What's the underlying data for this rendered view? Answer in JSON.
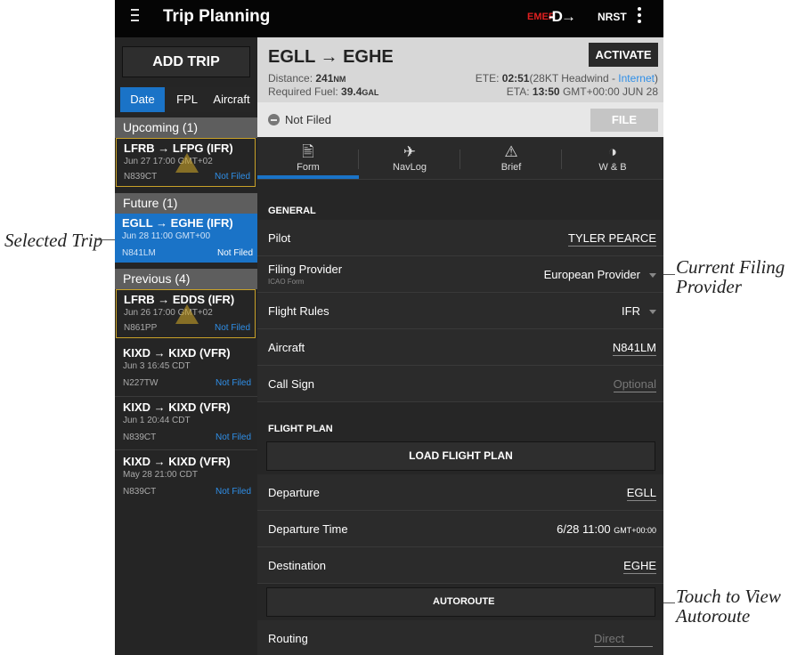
{
  "annotations": {
    "selected_trip": "Selected Trip",
    "current_filing_provider": [
      "Current Filing",
      "Provider"
    ],
    "touch_autoroute": [
      "Touch to View",
      "Autoroute"
    ]
  },
  "topbar": {
    "title": "Trip Planning",
    "emer": "EMER",
    "direct_to": "-D→",
    "nrst": "NRST"
  },
  "left": {
    "add_trip": "ADD TRIP",
    "segments": [
      "Date",
      "FPL",
      "Aircraft"
    ],
    "sections": {
      "upcoming": "Upcoming (1)",
      "future": "Future (1)",
      "previous": "Previous (4)"
    },
    "trips": [
      {
        "route": "LFRB → LFPG (IFR)",
        "date": "Jun 27 17:00 GMT+02",
        "tail": "N839CT",
        "status": "Not Filed"
      },
      {
        "route": "EGLL → EGHE (IFR)",
        "date": "Jun 28 11:00 GMT+00",
        "tail": "N841LM",
        "status": "Not Filed"
      },
      {
        "route": "LFRB → EDDS (IFR)",
        "date": "Jun 26 17:00 GMT+02",
        "tail": "N861PP",
        "status": "Not Filed"
      },
      {
        "route": "KIXD → KIXD (VFR)",
        "date": "Jun 3 16:45 CDT",
        "tail": "N227TW",
        "status": "Not Filed"
      },
      {
        "route": "KIXD → KIXD (VFR)",
        "date": "Jun 1 20:44 CDT",
        "tail": "N839CT",
        "status": "Not Filed"
      },
      {
        "route": "KIXD → KIXD (VFR)",
        "date": "May 28 21:00 CDT",
        "tail": "N839CT",
        "status": "Not Filed"
      }
    ]
  },
  "summary": {
    "route": "EGLL → EGHE",
    "distance_label": "Distance: ",
    "distance_value": "241",
    "distance_unit": "NM",
    "fuel_label": "Required Fuel: ",
    "fuel_value": "39.4",
    "fuel_unit": "GAL",
    "activate": "ACTIVATE",
    "ete_label": "ETE: ",
    "ete_value": "02:51",
    "ete_wind": "(28KT Headwind - ",
    "ete_source": "Internet",
    "ete_close": ")",
    "eta_label": "ETA: ",
    "eta_value": "13:50",
    "eta_zone": " GMT+00:00 JUN 28"
  },
  "filing": {
    "status": "Not Filed",
    "file_button": "FILE"
  },
  "tabs": [
    {
      "label": "Form",
      "icon": "form-icon"
    },
    {
      "label": "NavLog",
      "icon": "navlog-icon"
    },
    {
      "label": "Brief",
      "icon": "brief-icon"
    },
    {
      "label": "W & B",
      "icon": "weight-balance-icon"
    }
  ],
  "form": {
    "general_title": "GENERAL",
    "pilot_label": "Pilot",
    "pilot_value": "TYLER PEARCE",
    "provider_label": "Filing Provider",
    "provider_sub": "ICAO Form",
    "provider_value": "European Provider",
    "rules_label": "Flight Rules",
    "rules_value": "IFR",
    "aircraft_label": "Aircraft",
    "aircraft_value": "N841LM",
    "callsign_label": "Call Sign",
    "callsign_placeholder": "Optional",
    "flightplan_title": "FLIGHT PLAN",
    "load_fpl": "LOAD FLIGHT PLAN",
    "departure_label": "Departure",
    "departure_value": "EGLL",
    "dep_time_label": "Departure Time",
    "dep_time_value": "6/28 11:00",
    "dep_time_zone": "GMT+00:00",
    "destination_label": "Destination",
    "destination_value": "EGHE",
    "autoroute": "AUTOROUTE",
    "routing_label": "Routing",
    "routing_placeholder": "Direct"
  }
}
